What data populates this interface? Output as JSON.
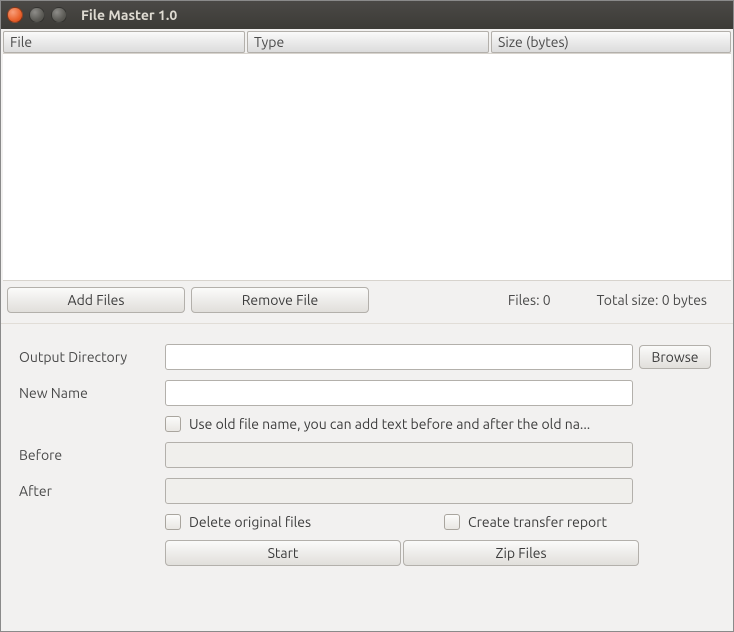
{
  "window": {
    "title": "File Master 1.0"
  },
  "columns": {
    "file": "File",
    "type": "Type",
    "size": "Size (bytes)"
  },
  "actions": {
    "add_files": "Add Files",
    "remove_file": "Remove File"
  },
  "stats": {
    "files_label": "Files:",
    "files_value": "0",
    "total_label": "Total size:",
    "total_value": "0 bytes"
  },
  "form": {
    "output_dir_label": "Output Directory",
    "browse_label": "Browse",
    "new_name_label": "New Name",
    "use_old_name_label": "Use old file name, you can add text before and after the old na...",
    "before_label": "Before",
    "after_label": "After",
    "delete_original_label": "Delete original files",
    "create_report_label": "Create transfer report",
    "start_label": "Start",
    "zip_label": "Zip Files",
    "output_dir_value": "",
    "new_name_value": "",
    "before_value": "",
    "after_value": ""
  }
}
